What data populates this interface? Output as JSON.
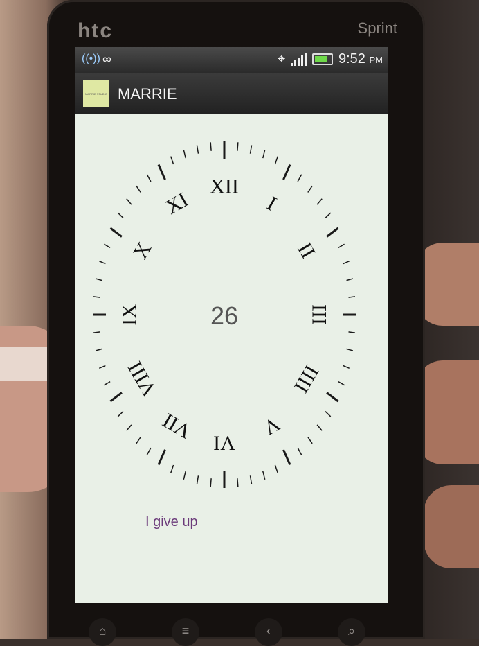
{
  "device": {
    "brand_left": "htc",
    "brand_right": "Sprint"
  },
  "status_bar": {
    "time": "9:52",
    "ampm": "PM",
    "icons": [
      "wifi-hotspot-icon",
      "voicemail-icon",
      "gps-icon",
      "signal-icon",
      "battery-icon"
    ]
  },
  "app": {
    "logo_text": "MARRIE STUDIO",
    "title": "MARRIE"
  },
  "clock": {
    "center_value": "26",
    "numerals": [
      "XII",
      "I",
      "II",
      "III",
      "IIII",
      "V",
      "VI",
      "VII",
      "VIII",
      "IX",
      "X",
      "XI"
    ]
  },
  "give_up_label": "I give up",
  "nav": {
    "icons": [
      "home-icon",
      "menu-icon",
      "back-icon",
      "search-icon"
    ]
  },
  "colors": {
    "screen_bg": "#e9f0e7",
    "accent_link": "#6b3a7a",
    "tick": "#1a1a1a"
  }
}
